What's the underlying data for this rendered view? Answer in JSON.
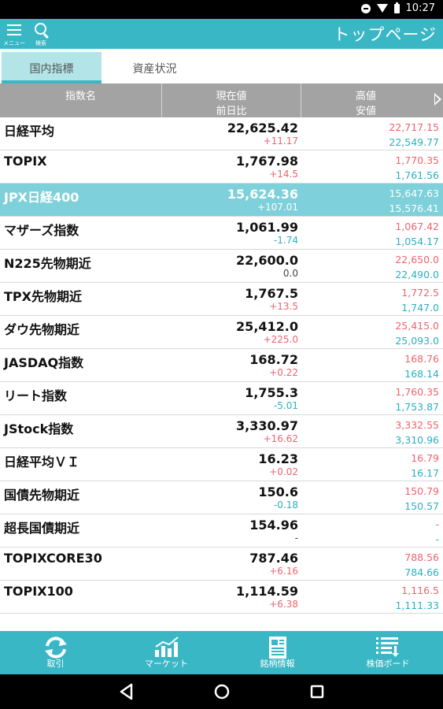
{
  "status_bar": {
    "time": "10:27"
  },
  "app_bar": {
    "menu_label": "メニュー",
    "search_label": "検索",
    "title": "トップページ"
  },
  "tabs": [
    {
      "label": "国内指標",
      "active": true
    },
    {
      "label": "資産状況",
      "active": false
    }
  ],
  "table": {
    "headers": {
      "name": "指数名",
      "price_line1": "現在値",
      "price_line2": "前日比",
      "range_line1": "高値",
      "range_line2": "安値"
    },
    "rows": [
      {
        "name": "日経平均",
        "value": "22,625.42",
        "change": "+11.17",
        "dir": "up",
        "high": "22,717.15",
        "low": "22,549.77"
      },
      {
        "name": "TOPIX",
        "value": "1,767.98",
        "change": "+14.5",
        "dir": "up",
        "high": "1,770.35",
        "low": "1,761.56"
      },
      {
        "name": "JPX日経400",
        "value": "15,624.36",
        "change": "+107.01",
        "dir": "up",
        "high": "15,647.63",
        "low": "15,576.41",
        "highlight": true
      },
      {
        "name": "マザーズ指数",
        "value": "1,061.99",
        "change": "-1.74",
        "dir": "down",
        "high": "1,067.42",
        "low": "1,054.17"
      },
      {
        "name": "N225先物期近",
        "value": "22,600.0",
        "change": "0.0",
        "dir": "flat",
        "high": "22,650.0",
        "low": "22,490.0"
      },
      {
        "name": "TPX先物期近",
        "value": "1,767.5",
        "change": "+13.5",
        "dir": "up",
        "high": "1,772.5",
        "low": "1,747.0"
      },
      {
        "name": "ダウ先物期近",
        "value": "25,412.0",
        "change": "+225.0",
        "dir": "up",
        "high": "25,415.0",
        "low": "25,093.0"
      },
      {
        "name": "JASDAQ指数",
        "value": "168.72",
        "change": "+0.22",
        "dir": "up",
        "high": "168.76",
        "low": "168.14"
      },
      {
        "name": "リート指数",
        "value": "1,755.3",
        "change": "-5.01",
        "dir": "down",
        "high": "1,760.35",
        "low": "1,753.87"
      },
      {
        "name": "JStock指数",
        "value": "3,330.97",
        "change": "+16.62",
        "dir": "up",
        "high": "3,332.55",
        "low": "3,310.96"
      },
      {
        "name": "日経平均ＶＩ",
        "value": "16.23",
        "change": "+0.02",
        "dir": "up",
        "high": "16.79",
        "low": "16.17"
      },
      {
        "name": "国債先物期近",
        "value": "150.6",
        "change": "-0.18",
        "dir": "down",
        "high": "150.79",
        "low": "150.57"
      },
      {
        "name": "超長国債期近",
        "value": "154.96",
        "change": "-",
        "dir": "flat",
        "high": "-",
        "low": "-"
      },
      {
        "name": "TOPIXCORE30",
        "value": "787.46",
        "change": "+6.16",
        "dir": "up",
        "high": "788.56",
        "low": "784.66"
      },
      {
        "name": "TOPIX100",
        "value": "1,114.59",
        "change": "+6.38",
        "dir": "up",
        "high": "1,116.5",
        "low": "1,111.33"
      }
    ]
  },
  "bottom_nav": [
    {
      "label": "取引",
      "icon": "refresh-arrows-icon"
    },
    {
      "label": "マーケット",
      "icon": "bar-chart-icon"
    },
    {
      "label": "銘柄情報",
      "icon": "document-icon"
    },
    {
      "label": "株価ボード",
      "icon": "board-list-icon"
    }
  ],
  "colors": {
    "accent": "#3ab7c4",
    "up": "#f0636f",
    "down": "#2bb0c2",
    "highlight_row": "#7ed0da"
  }
}
